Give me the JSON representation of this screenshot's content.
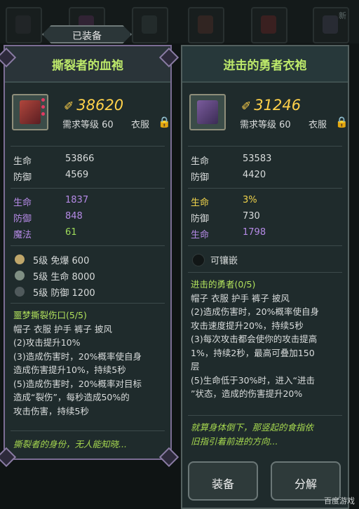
{
  "equipped_label": "已装备",
  "top_slots": {
    "new_tag": "新"
  },
  "left": {
    "title": "撕裂者的血袍",
    "power": "38620",
    "req": "需求等级 60",
    "slot": "衣服",
    "base": [
      {
        "label": "生命",
        "value": "53866"
      },
      {
        "label": "防御",
        "value": "4569"
      }
    ],
    "extra": [
      {
        "label": "生命",
        "value": "1837",
        "color": "#b58ae6"
      },
      {
        "label": "防御",
        "value": "848",
        "color": "#b58ae6"
      },
      {
        "label": "魔法",
        "value": "61",
        "color": "#9edc5a"
      }
    ],
    "gems": [
      {
        "text": "5级  免爆 600",
        "color": "#bfa66a"
      },
      {
        "text": "5级  生命 8000",
        "color": "#7f8f83"
      },
      {
        "text": "5级  防御 1200",
        "color": "#505a5c"
      }
    ],
    "set_title": "噩梦撕裂伤口(5/5)",
    "set_pieces": "帽子 衣服 护手 裤子 披风",
    "set_lines": [
      "(2)攻击提升10%",
      "(3)造成伤害时，20%概率使自身",
      "造成伤害提升10%，持续5秒",
      "(5)造成伤害时，20%概率对目标",
      "造成“裂伤”，每秒造成50%的",
      "攻击伤害，持续5秒"
    ],
    "flavor": "撕裂者的身份，无人能知晓..."
  },
  "right": {
    "title": "进击的勇者衣袍",
    "power": "31246",
    "req": "需求等级 60",
    "slot": "衣服",
    "base": [
      {
        "label": "生命",
        "value": "53583"
      },
      {
        "label": "防御",
        "value": "4420"
      }
    ],
    "extra": [
      {
        "label": "生命",
        "value": "3%",
        "color": "#f1d44b"
      },
      {
        "label": "防御",
        "value": "730",
        "color": "#d9dcdc"
      },
      {
        "label": "生命",
        "value": "1798",
        "color": "#b58ae6"
      }
    ],
    "socket_label": "可镶嵌",
    "set_title": "进击的勇者(0/5)",
    "set_pieces": "帽子 衣服 护手 裤子 披风",
    "set_lines": [
      "(2)造成伤害时，20%概率使自身",
      "攻击速度提升20%，持续5秒",
      "(3)每次攻击都会使你的攻击提高",
      "1%，持续2秒，最高可叠加150",
      "层",
      "(5)生命低于30%时，进入“进击",
      "”状态，造成的伤害提升20%"
    ],
    "flavor": [
      "就算身体倒下，那竖起的食指依",
      "旧指引着前进的方向..."
    ]
  },
  "buttons": {
    "equip": "装备",
    "decompose": "分解"
  },
  "watermark": "百度游戏",
  "colors": {
    "title_green": "#bde96a",
    "power_gold": "#ffd14a",
    "purple_stat": "#b58ae6"
  }
}
